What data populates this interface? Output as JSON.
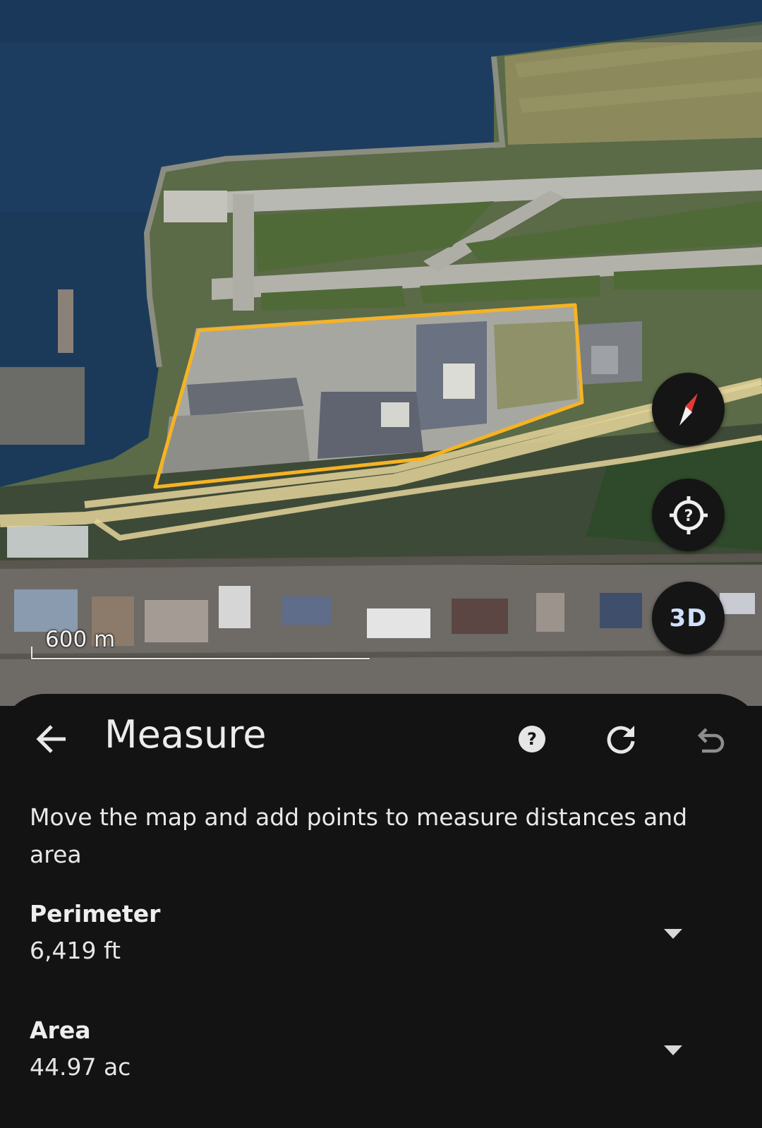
{
  "map": {
    "scale_label": "600 m",
    "measure_outline_color": "#f5b324",
    "road_color": "#e4d49a"
  },
  "controls": {
    "compass_icon": "compass-icon",
    "my_location_icon": "location-help-icon",
    "view_toggle_label": "3D"
  },
  "sheet": {
    "title": "Measure",
    "description": "Move the map and add points to measure distances and area",
    "icons": {
      "back": "arrow-back-icon",
      "help": "help-circle-icon",
      "refresh": "refresh-icon",
      "undo": "undo-icon"
    },
    "metrics": [
      {
        "label": "Perimeter",
        "value": "6,419 ft"
      },
      {
        "label": "Area",
        "value": "44.97 ac"
      }
    ]
  }
}
